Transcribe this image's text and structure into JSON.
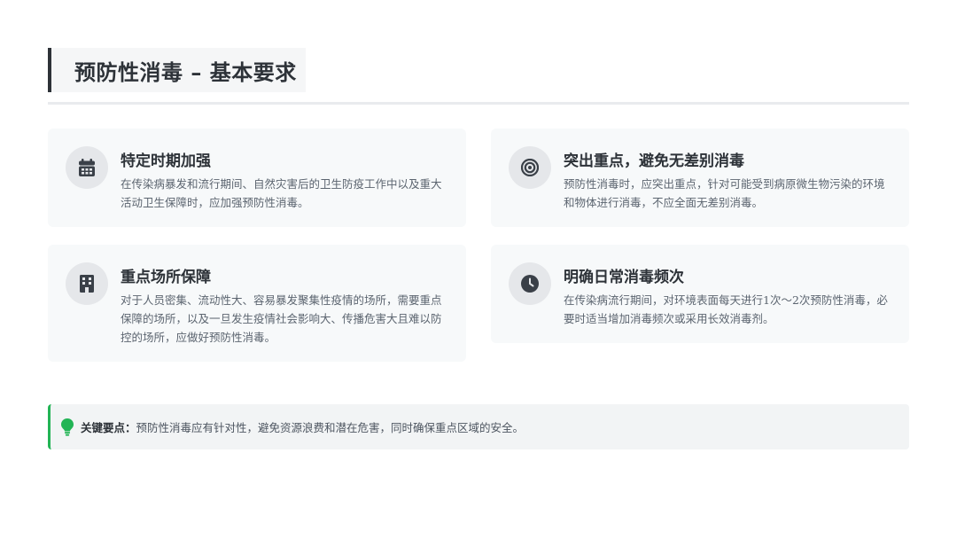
{
  "header": {
    "title": "预防性消毒 – 基本要求"
  },
  "cards": [
    {
      "icon": "calendar-icon",
      "title": "特定时期加强",
      "description": "在传染病暴发和流行期间、自然灾害后的卫生防疫工作中以及重大活动卫生保障时，应加强预防性消毒。"
    },
    {
      "icon": "target-icon",
      "title": "突出重点，避免无差别消毒",
      "description": "预防性消毒时，应突出重点，针对可能受到病原微生物污染的环境和物体进行消毒，不应全面无差别消毒。"
    },
    {
      "icon": "building-icon",
      "title": "重点场所保障",
      "description": "对于人员密集、流动性大、容易暴发聚集性疫情的场所，需要重点保障的场所，以及一旦发生疫情社会影响大、传播危害大且难以防控的场所，应做好预防性消毒。"
    },
    {
      "icon": "clock-icon",
      "title": "明确日常消毒频次",
      "description": "在传染病流行期间，对环境表面每天进行1次～2次预防性消毒，必要时适当增加消毒频次或采用长效消毒剂。"
    }
  ],
  "tip": {
    "icon": "lightbulb-icon",
    "label": "关键要点：",
    "text": "预防性消毒应有针对性，避免资源浪费和潜在危害，同时确保重点区域的安全。"
  },
  "colors": {
    "accent": "#22b455",
    "title_bar": "#2d3238",
    "icon": "#3a4048"
  }
}
